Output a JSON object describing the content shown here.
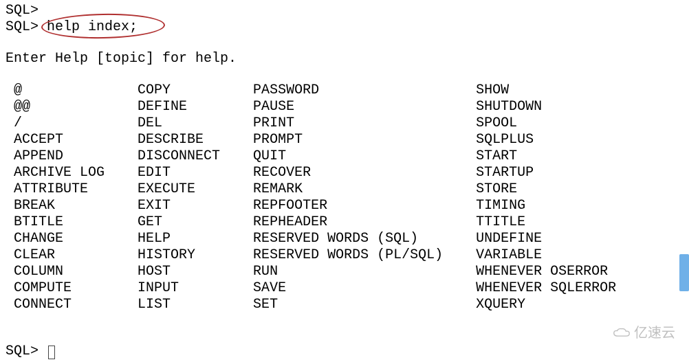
{
  "prompt": "SQL>",
  "command": "help index;",
  "header": "Enter Help [topic] for help.",
  "columns": {
    "col1": [
      "@",
      "@@",
      "/",
      "ACCEPT",
      "APPEND",
      "ARCHIVE LOG",
      "ATTRIBUTE",
      "BREAK",
      "BTITLE",
      "CHANGE",
      "CLEAR",
      "COLUMN",
      "COMPUTE",
      "CONNECT"
    ],
    "col2": [
      "COPY",
      "DEFINE",
      "DEL",
      "DESCRIBE",
      "DISCONNECT",
      "EDIT",
      "EXECUTE",
      "EXIT",
      "GET",
      "HELP",
      "HISTORY",
      "HOST",
      "INPUT",
      "LIST"
    ],
    "col3": [
      "PASSWORD",
      "PAUSE",
      "PRINT",
      "PROMPT",
      "QUIT",
      "RECOVER",
      "REMARK",
      "REPFOOTER",
      "REPHEADER",
      "RESERVED WORDS (SQL)",
      "RESERVED WORDS (PL/SQL)",
      "RUN",
      "SAVE",
      "SET"
    ],
    "col4": [
      "SHOW",
      "SHUTDOWN",
      "SPOOL",
      "SQLPLUS",
      "START",
      "STARTUP",
      "STORE",
      "TIMING",
      "TTITLE",
      "UNDEFINE",
      "VARIABLE",
      "WHENEVER OSERROR",
      "WHENEVER SQLERROR",
      "XQUERY"
    ]
  },
  "watermark": "亿速云"
}
